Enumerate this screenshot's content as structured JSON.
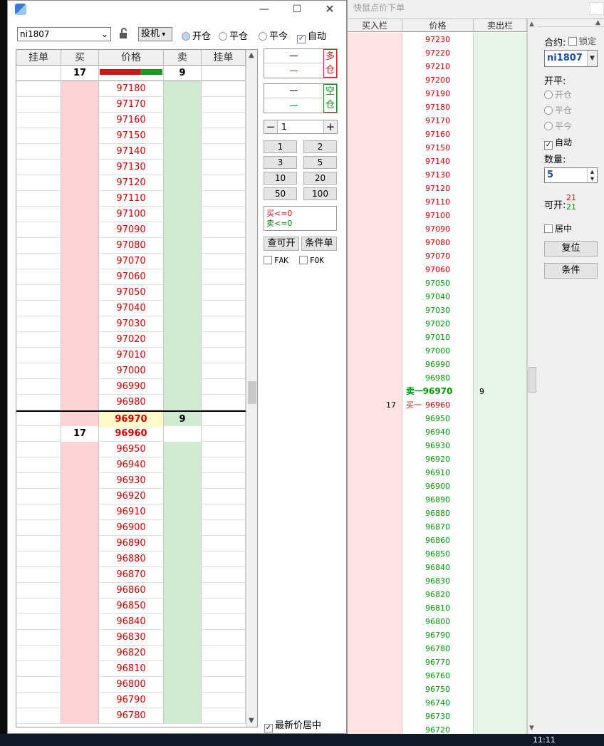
{
  "colors": {
    "buy_bg": "#ffd3d3",
    "sell_bg": "#cfeacf",
    "ask_price": "#d40000",
    "bid_price": "#009900",
    "last_bg": "#fff8c8"
  },
  "win1": {
    "contract": "ni1807",
    "mode": "投机",
    "radios": [
      "开仓",
      "平仓",
      "平今"
    ],
    "auto_label": "自动",
    "headers": [
      "挂单",
      "买",
      "价格",
      "卖",
      "挂单"
    ],
    "summary": {
      "buy": "17",
      "sell": "9",
      "buy_ratio": 0.65
    },
    "upper_prices": [
      "97180",
      "97170",
      "97160",
      "97150",
      "97140",
      "97130",
      "97120",
      "97110",
      "97100",
      "97090",
      "97080",
      "97070",
      "97060",
      "97050",
      "97040",
      "97030",
      "97020",
      "97010",
      "97000",
      "96990",
      "96980"
    ],
    "last": {
      "price": "96970",
      "sell": "9"
    },
    "bid": {
      "price": "96960",
      "buy": "17"
    },
    "lower_prices": [
      "96950",
      "96940",
      "96930",
      "96920",
      "96910",
      "96900",
      "96890",
      "96880",
      "96870",
      "96860",
      "96850",
      "96840",
      "96830",
      "96820",
      "96810",
      "96800",
      "96790",
      "96780"
    ],
    "long": {
      "label1": "多",
      "label2": "仓",
      "v1": "一",
      "v2": "—"
    },
    "short": {
      "label1": "空",
      "label2": "仓",
      "v1": "一",
      "v2": "—"
    },
    "qty": "1",
    "qty_btns": [
      "1",
      "2",
      "3",
      "5",
      "10",
      "20",
      "50",
      "100"
    ],
    "limits": {
      "buy": "买<=0",
      "sell": "卖<=0"
    },
    "check_btn": "查可开",
    "cond_btn": "条件单",
    "fak": "FAK",
    "fok": "FOK",
    "center_label": "最新价居中"
  },
  "win2": {
    "title": "快鼠点价下单",
    "headers": [
      "买入栏",
      "价格",
      "卖出栏"
    ],
    "upper_prices": [
      "97230",
      "97220",
      "97210",
      "97200",
      "97190",
      "97180",
      "97170",
      "97160",
      "97150",
      "97140",
      "97130",
      "97120",
      "97110",
      "97100",
      "97090",
      "97080",
      "97070",
      "97060"
    ],
    "mid_prices": [
      "97050",
      "97040",
      "97030",
      "97020",
      "97010",
      "97000",
      "96990",
      "96980"
    ],
    "ask": {
      "label": "卖一",
      "price": "96970",
      "qty": "9"
    },
    "bid": {
      "label": "买一",
      "price": "96960",
      "qty": "17"
    },
    "lower_prices": [
      "96950",
      "96940",
      "96930",
      "96920",
      "96910",
      "96900",
      "96890",
      "96880",
      "96870",
      "96860",
      "96850",
      "96840",
      "96830",
      "96820",
      "96810",
      "96800",
      "96790",
      "96780",
      "96770",
      "96760",
      "96750",
      "96740",
      "96730",
      "96720"
    ],
    "side": {
      "contract_label": "合约:",
      "lock_label": "锁定",
      "contract": "ni1807",
      "openclose_label": "开平:",
      "radios": [
        "开仓",
        "平仓",
        "平今"
      ],
      "auto_label": "自动",
      "qty_label": "数量:",
      "qty": "5",
      "avail_label": "可开:",
      "avail_buy": "21",
      "avail_sell": "21",
      "center_label": "居中",
      "reset_btn": "复位",
      "cond_btn": "条件"
    }
  },
  "taskbar": {
    "time": "11:11"
  }
}
